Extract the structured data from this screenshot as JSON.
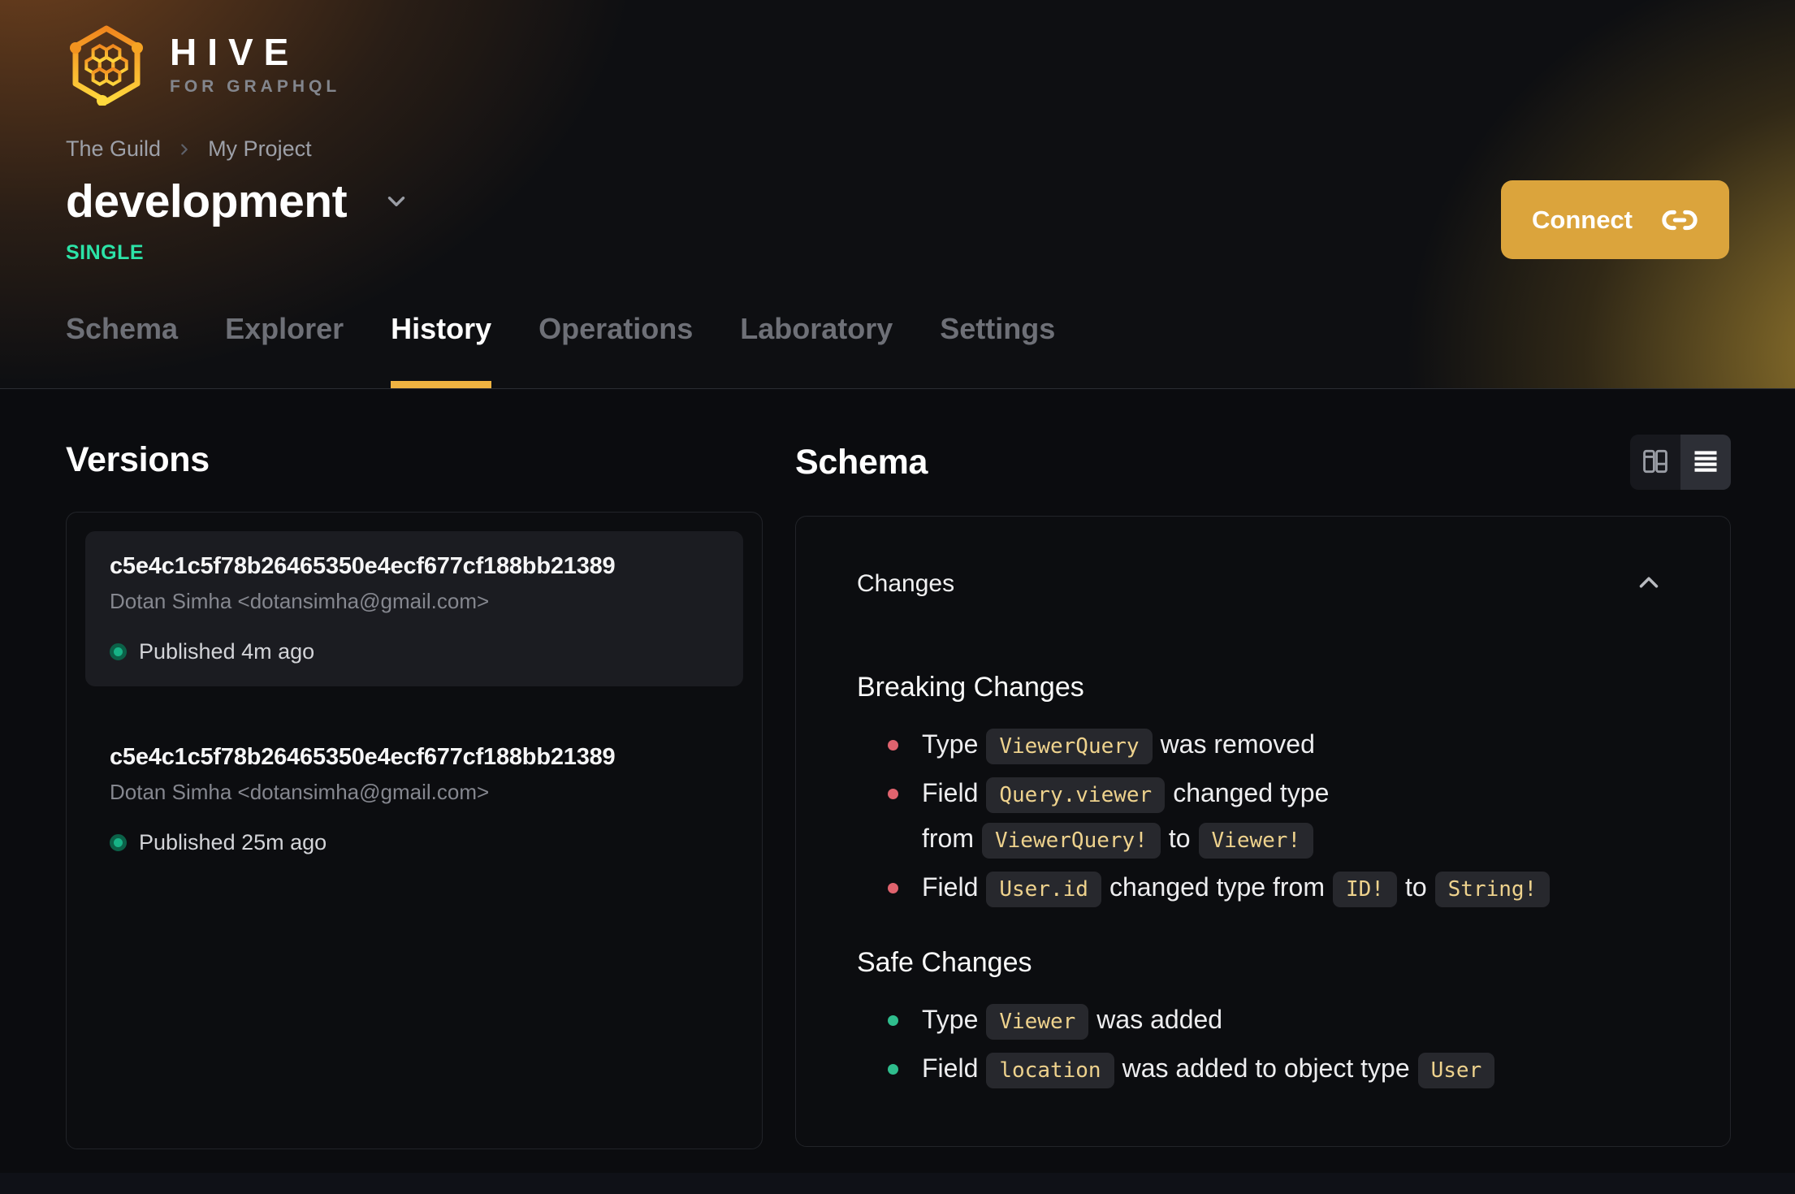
{
  "brand": {
    "name": "HIVE",
    "tagline": "FOR GRAPHQL"
  },
  "breadcrumb": {
    "items": [
      "The Guild",
      "My Project"
    ]
  },
  "header": {
    "target_name": "development",
    "badge": "SINGLE",
    "connect_label": "Connect"
  },
  "tabs": [
    {
      "label": "Schema",
      "active": false
    },
    {
      "label": "Explorer",
      "active": false
    },
    {
      "label": "History",
      "active": true
    },
    {
      "label": "Operations",
      "active": false
    },
    {
      "label": "Laboratory",
      "active": false
    },
    {
      "label": "Settings",
      "active": false
    }
  ],
  "versions": {
    "title": "Versions",
    "items": [
      {
        "hash": "c5e4c1c5f78b26465350e4ecf677cf188bb21389",
        "author": "Dotan Simha <dotansimha@gmail.com>",
        "status": "Published 4m ago",
        "selected": true
      },
      {
        "hash": "c5e4c1c5f78b26465350e4ecf677cf188bb21389",
        "author": "Dotan Simha <dotansimha@gmail.com>",
        "status": "Published 25m ago",
        "selected": false
      }
    ]
  },
  "schema_panel": {
    "title": "Schema",
    "view_toggle": {
      "options": [
        "split-view",
        "list-view"
      ],
      "active": "list-view"
    },
    "changes_title": "Changes",
    "collapsed": false,
    "sections": [
      {
        "title": "Breaking Changes",
        "kind": "breaking",
        "items": [
          {
            "parts": [
              {
                "t": "text",
                "v": "Type"
              },
              {
                "t": "code",
                "v": "ViewerQuery"
              },
              {
                "t": "text",
                "v": "was removed"
              }
            ]
          },
          {
            "parts": [
              {
                "t": "text",
                "v": "Field"
              },
              {
                "t": "code",
                "v": "Query.viewer"
              },
              {
                "t": "text",
                "v": "changed type from"
              },
              {
                "t": "code",
                "v": "ViewerQuery!"
              },
              {
                "t": "text",
                "v": "to"
              },
              {
                "t": "code",
                "v": "Viewer!"
              }
            ]
          },
          {
            "parts": [
              {
                "t": "text",
                "v": "Field"
              },
              {
                "t": "code",
                "v": "User.id"
              },
              {
                "t": "text",
                "v": "changed type from"
              },
              {
                "t": "code",
                "v": "ID!"
              },
              {
                "t": "text",
                "v": "to"
              },
              {
                "t": "code",
                "v": "String!"
              }
            ]
          }
        ]
      },
      {
        "title": "Safe Changes",
        "kind": "safe",
        "items": [
          {
            "parts": [
              {
                "t": "text",
                "v": "Type"
              },
              {
                "t": "code",
                "v": "Viewer"
              },
              {
                "t": "text",
                "v": "was added"
              }
            ]
          },
          {
            "parts": [
              {
                "t": "text",
                "v": "Field"
              },
              {
                "t": "code",
                "v": "location"
              },
              {
                "t": "text",
                "v": "was added to object type"
              },
              {
                "t": "code",
                "v": "User"
              }
            ]
          }
        ]
      }
    ]
  },
  "icons": {
    "logo": "hive-logo-icon",
    "breadcrumb_separator": "chevron-right-icon",
    "target_selector": "chevron-down-icon",
    "connect": "link-icon",
    "view_split": "columns-view-icon",
    "view_list": "list-view-icon",
    "collapse": "chevron-up-icon"
  },
  "colors": {
    "accent": "#efb341",
    "connect": "#dba43c",
    "badge": "#2ce3a7",
    "breaking": "#e0636e",
    "safe": "#2fbd8d",
    "code": "#eed28d"
  }
}
